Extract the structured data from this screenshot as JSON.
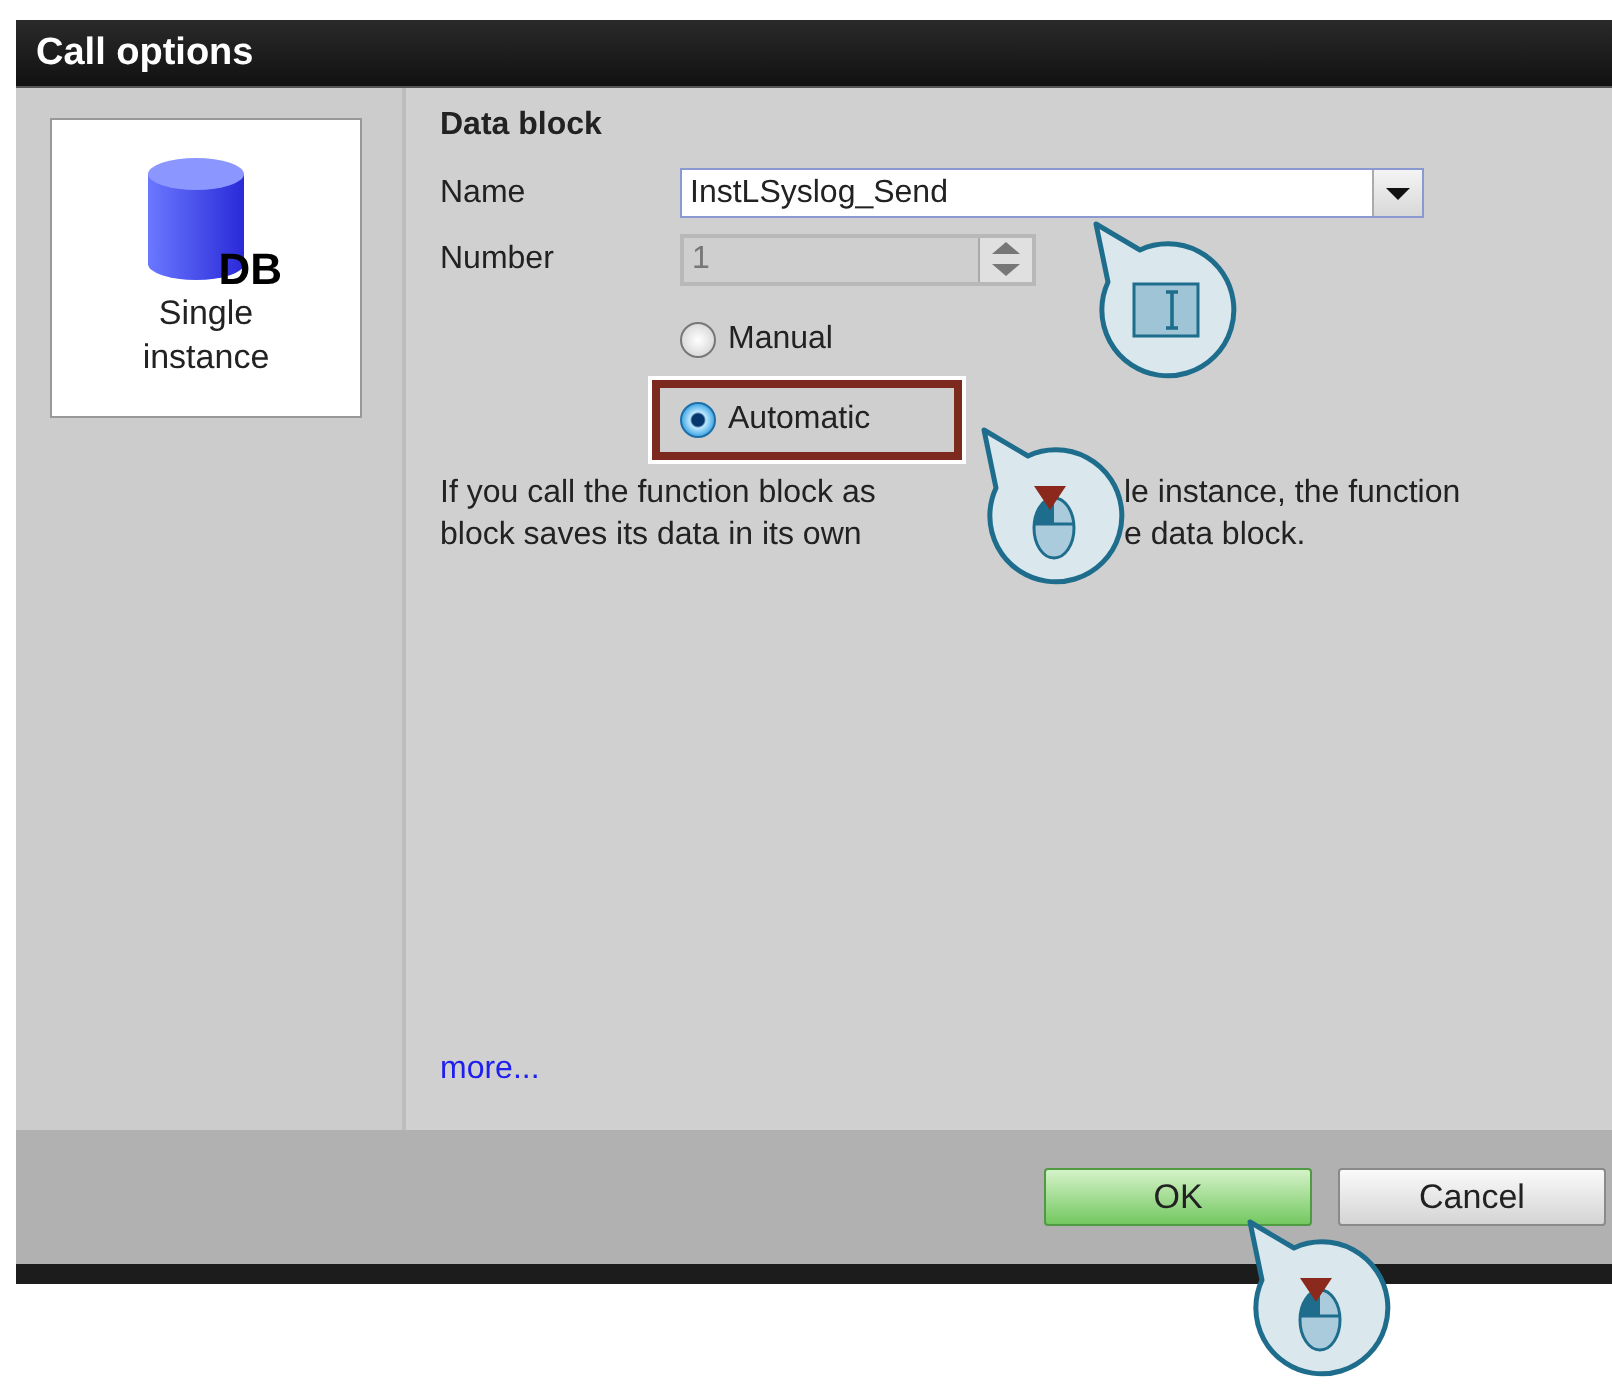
{
  "window": {
    "title": "Call options"
  },
  "sidebar": {
    "items": [
      {
        "icon_label": "DB",
        "label": "Single instance"
      }
    ]
  },
  "data_block": {
    "heading": "Data block",
    "name": {
      "label": "Name",
      "value": "InstLSyslog_Send"
    },
    "number": {
      "label": "Number",
      "value": "1",
      "disabled": true
    },
    "options": [
      {
        "label": "Manual",
        "selected": false,
        "highlighted": false
      },
      {
        "label": "Automatic",
        "selected": true,
        "highlighted": true
      }
    ],
    "description_lines": [
      [
        "If you call the function block as",
        "le instance, the function"
      ],
      [
        "block saves its data in its own",
        "e data block."
      ]
    ],
    "more_link": "more..."
  },
  "buttons": [
    {
      "label": "OK",
      "default": true
    },
    {
      "label": "Cancel",
      "default": false
    }
  ]
}
